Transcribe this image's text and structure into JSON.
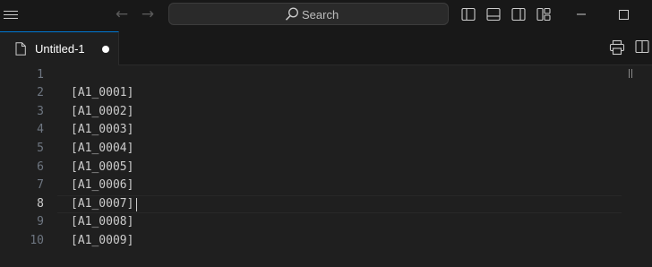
{
  "titlebar": {
    "search_label": "Search",
    "back_arrow": "←",
    "forward_arrow": "→",
    "icons": [
      "menu-icon",
      "back-arrow-icon",
      "forward-arrow-icon",
      "search-icon",
      "toggle-primary-sidebar-icon",
      "toggle-panel-icon",
      "toggle-secondary-sidebar-icon",
      "customize-layout-icon",
      "minimize-icon",
      "maximize-icon"
    ]
  },
  "tab": {
    "label": "Untitled-1",
    "modified": true
  },
  "editor_actions": [
    "print-icon",
    "split-editor-icon"
  ],
  "editor": {
    "current_line": 8,
    "lines": [
      {
        "num": "1",
        "text": ""
      },
      {
        "num": "2",
        "text": "[A1_0001]"
      },
      {
        "num": "3",
        "text": "[A1_0002]"
      },
      {
        "num": "4",
        "text": "[A1_0003]"
      },
      {
        "num": "5",
        "text": "[A1_0004]"
      },
      {
        "num": "6",
        "text": "[A1_0005]"
      },
      {
        "num": "7",
        "text": "[A1_0006]"
      },
      {
        "num": "8",
        "text": "[A1_0007]"
      },
      {
        "num": "9",
        "text": "[A1_0008]"
      },
      {
        "num": "10",
        "text": "[A1_0009]"
      }
    ]
  },
  "colors": {
    "background": "#1f1f1f",
    "titlebar": "#181818",
    "accent": "#0078d4",
    "line_number": "#6e7681",
    "text": "#cccccc"
  }
}
